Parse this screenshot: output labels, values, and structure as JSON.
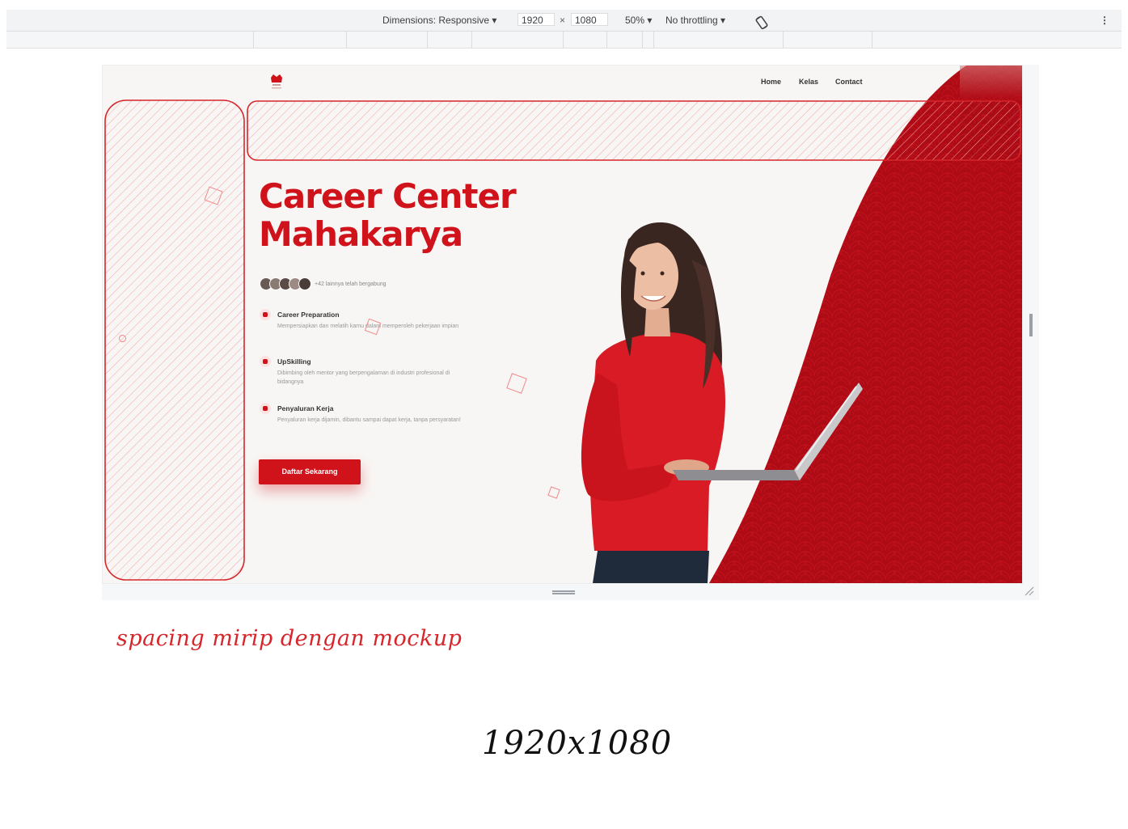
{
  "devtools": {
    "dimensions_label": "Dimensions: Responsive ▾",
    "width_value": "1920",
    "times_sign": "×",
    "height_value": "1080",
    "zoom_label": "50% ▾",
    "throttling_label": "No throttling ▾",
    "more_icon": "⋮"
  },
  "site": {
    "nav": {
      "home": "Home",
      "kelas": "Kelas",
      "contact": "Contact"
    },
    "hero": {
      "title_line1": "Career Center",
      "title_line2": "Mahakarya",
      "joined_text": "+42 lainnya telah bergabung",
      "features": [
        {
          "title": "Career Preparation",
          "desc": "Mempersiapkan dan melatih kamu dalam memperoleh pekerjaan impian"
        },
        {
          "title": "UpSkilling",
          "desc": "Dibimbing oleh mentor yang berpengalaman di industri profesional di bidangnya"
        },
        {
          "title": "Penyaluran Kerja",
          "desc": "Penyaluran kerja dijamin, dibantu sampai dapat kerja, tanpa persyaratan!"
        }
      ],
      "cta_label": "Daftar Sekarang"
    },
    "colors": {
      "brand_red": "#d0121b",
      "background": "#f8f6f4",
      "annotation_red": "#d6262b"
    }
  },
  "annotations": {
    "note_spacing": "spacing mirip dengan mockup",
    "note_size": "1920x1080"
  }
}
